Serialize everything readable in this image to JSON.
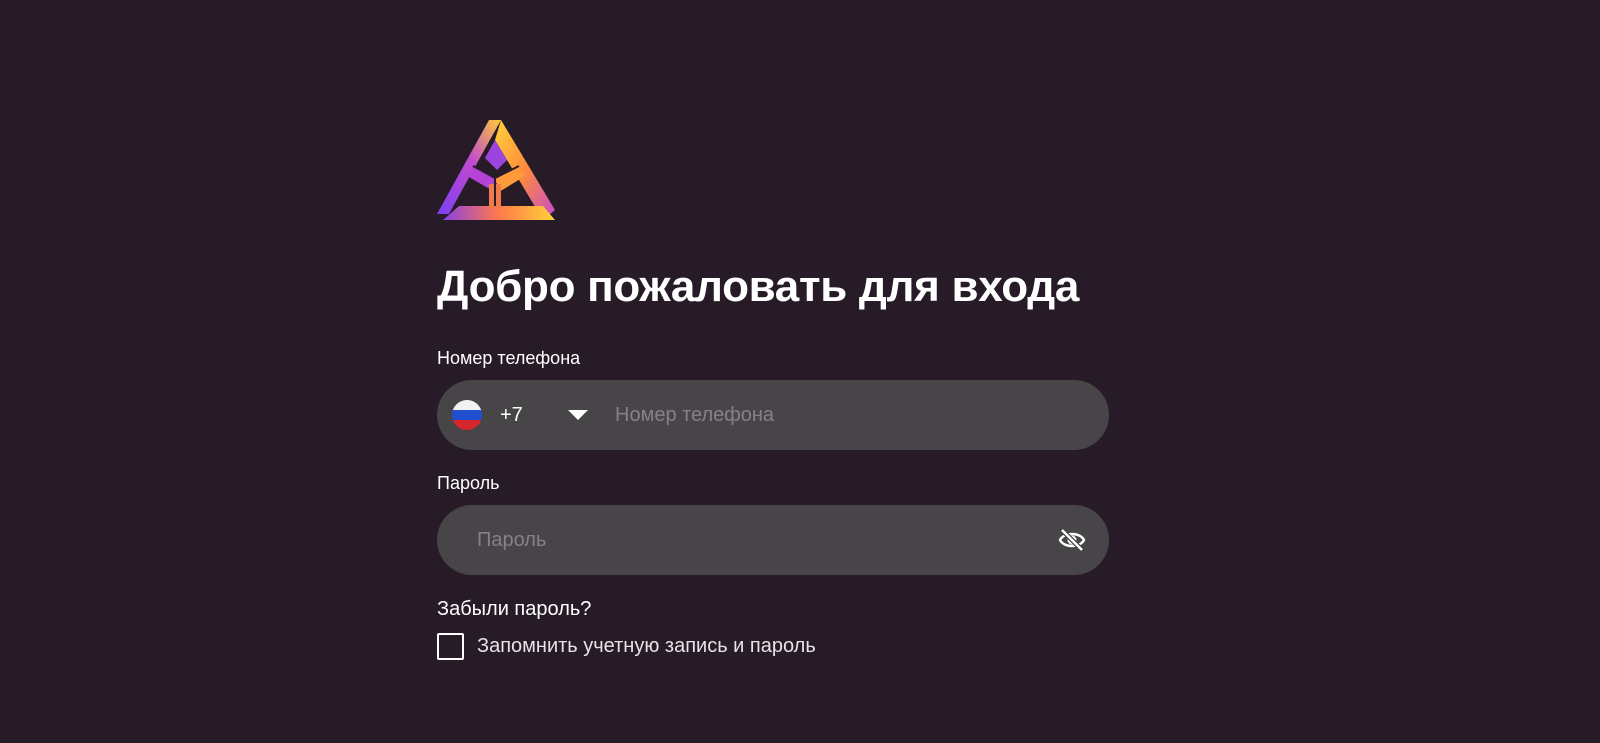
{
  "form": {
    "title": "Добро пожаловать для входа",
    "phone": {
      "label": "Номер телефона",
      "country_code": "+7",
      "country_flag": "russia-flag-icon",
      "placeholder": "Номер телефона",
      "value": ""
    },
    "password": {
      "label": "Пароль",
      "placeholder": "Пароль",
      "value": "",
      "toggle_icon": "eye-off-icon"
    },
    "forgot_link": "Забыли пароль?",
    "remember": {
      "label": "Запомнить учетную запись и пароль",
      "checked": false
    }
  },
  "colors": {
    "background": "#261b27",
    "input_background": "#484548",
    "placeholder": "#858185",
    "logo_purple": "#8a3fe6",
    "logo_orange": "#ff8a3d",
    "logo_yellow": "#ffd23a"
  }
}
